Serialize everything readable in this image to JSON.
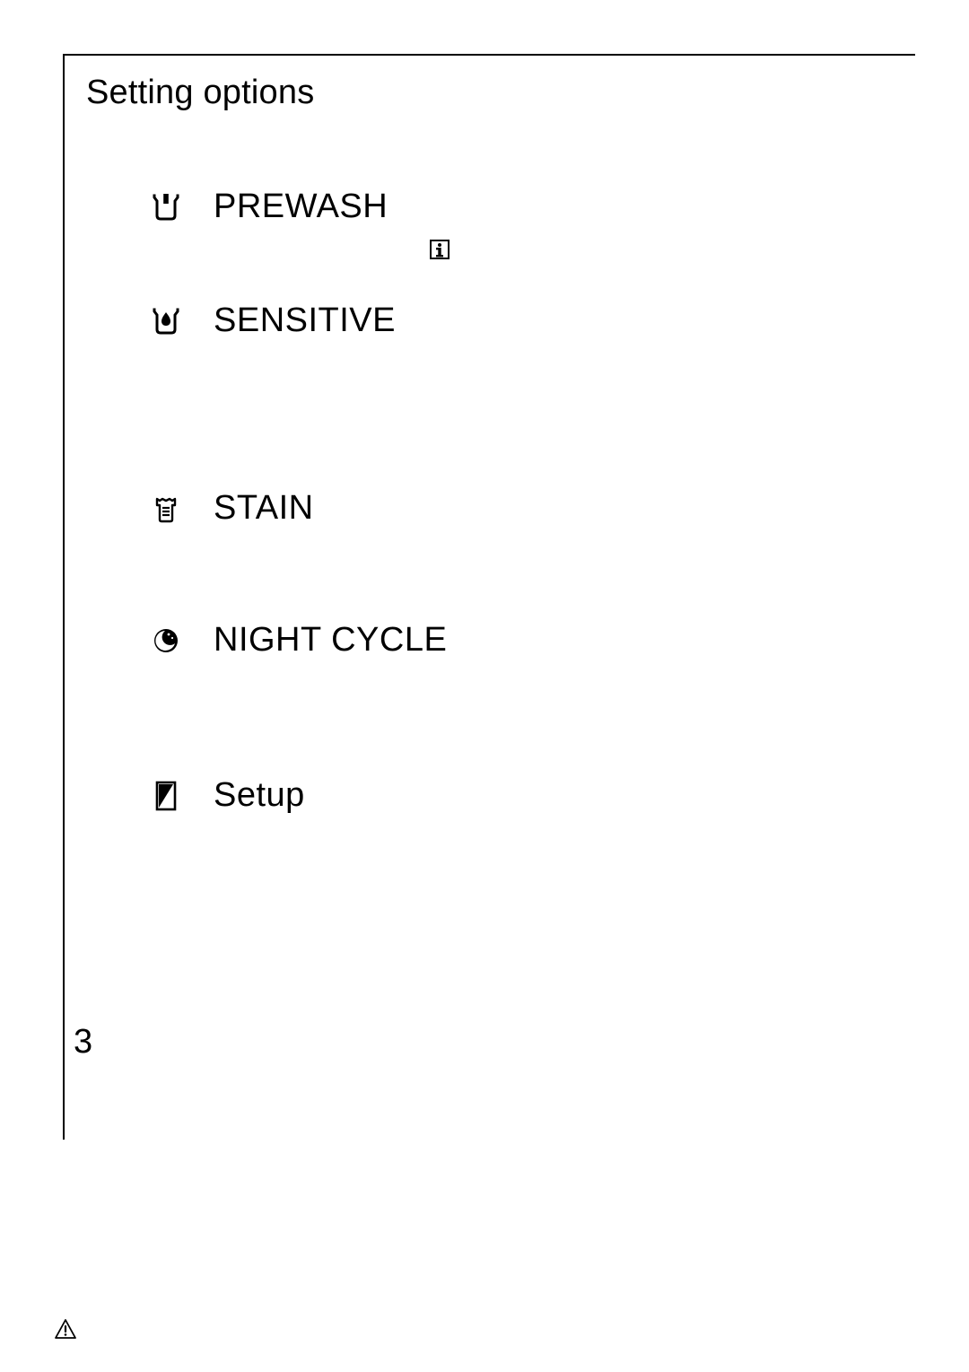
{
  "title": "Setting options",
  "page_number": "3",
  "options": {
    "prewash": {
      "label": "PREWASH"
    },
    "sensitive": {
      "label": "SENSITIVE"
    },
    "stain": {
      "label": "STAIN"
    },
    "night_cycle": {
      "label": "NIGHT CYCLE"
    },
    "setup": {
      "label": "Setup"
    }
  }
}
